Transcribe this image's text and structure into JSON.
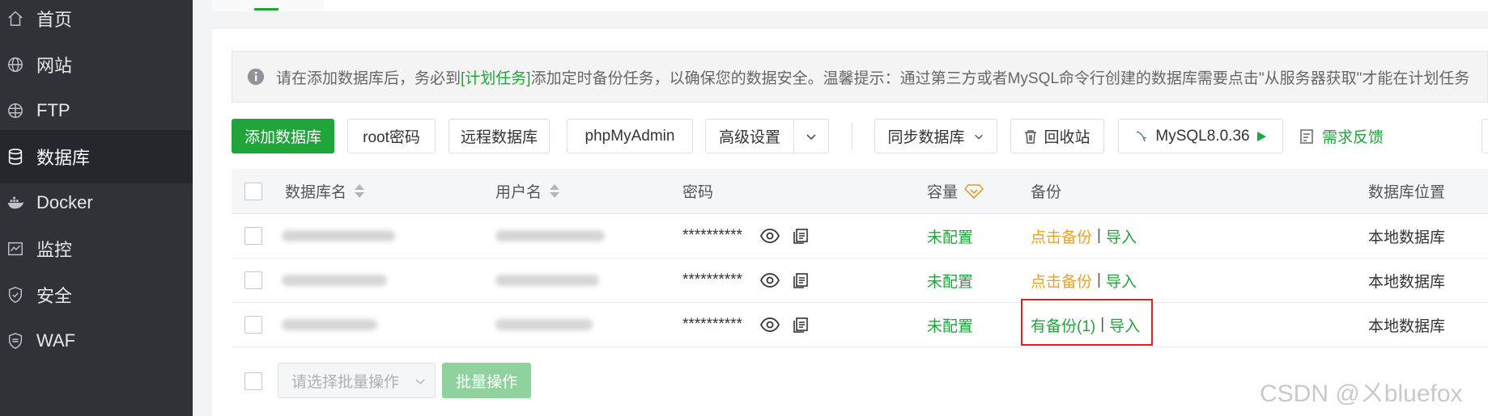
{
  "sidebar": {
    "items": [
      {
        "label": "首页",
        "icon": "home-icon"
      },
      {
        "label": "网站",
        "icon": "globe-icon"
      },
      {
        "label": "FTP",
        "icon": "ftp-globe-icon"
      },
      {
        "label": "数据库",
        "icon": "database-icon",
        "active": true
      },
      {
        "label": "Docker",
        "icon": "docker-icon"
      },
      {
        "label": "监控",
        "icon": "monitor-icon"
      },
      {
        "label": "安全",
        "icon": "shield-icon"
      },
      {
        "label": "WAF",
        "icon": "waf-shield-icon"
      }
    ]
  },
  "alert": {
    "text_before": "请在添加数据库后，务必到",
    "link": "[计划任务]",
    "text_after": "添加定时备份任务，以确保您的数据安全。温馨提示：通过第三方或者MySQL命令行创建的数据库需要点击\"从服务器获取\"才能在计划任务"
  },
  "toolbar": {
    "add_db": "添加数据库",
    "root_pwd": "root密码",
    "remote_db": "远程数据库",
    "phpmyadmin": "phpMyAdmin",
    "advanced": "高级设置",
    "sync_db": "同步数据库",
    "recycle": "回收站",
    "mysql_version": "MySQL8.0.36",
    "feedback": "需求反馈"
  },
  "table": {
    "headers": {
      "name": "数据库名",
      "user": "用户名",
      "password": "密码",
      "capacity": "容量",
      "backup": "备份",
      "location": "数据库位置"
    },
    "rows": [
      {
        "password": "**********",
        "capacity": "未配置",
        "backup": "点击备份",
        "import": "导入",
        "location": "本地数据库",
        "backup_status": "none"
      },
      {
        "password": "**********",
        "capacity": "未配置",
        "backup": "点击备份",
        "import": "导入",
        "location": "本地数据库",
        "backup_status": "none"
      },
      {
        "password": "**********",
        "capacity": "未配置",
        "backup": "有备份(1)",
        "import": "导入",
        "location": "本地数据库",
        "backup_status": "exists"
      }
    ]
  },
  "footer": {
    "batch_placeholder": "请选择批量操作",
    "batch_button": "批量操作"
  },
  "watermark": "CSDN @ㄨbluefox",
  "colors": {
    "accent": "#20a53a",
    "warning": "#f0a020",
    "highlight": "#e02020",
    "sidebar": "#2f3237"
  }
}
